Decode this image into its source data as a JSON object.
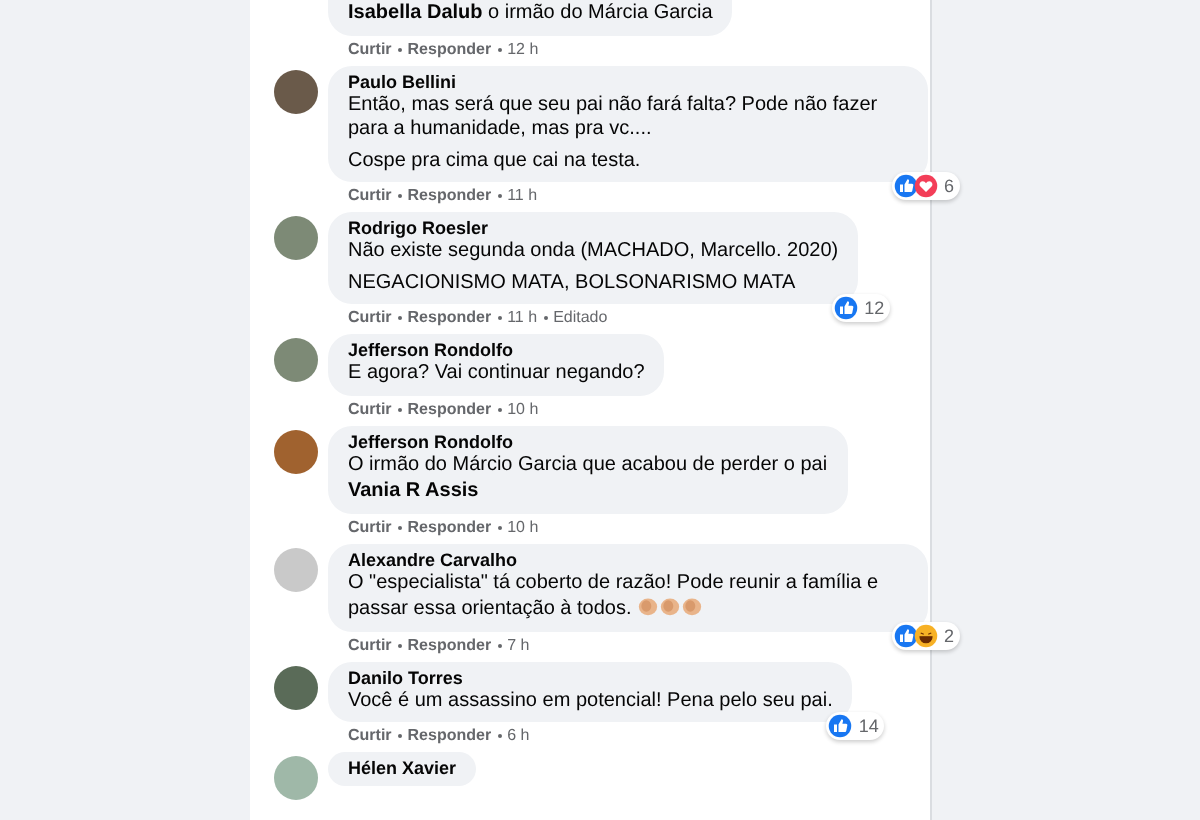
{
  "comments": [
    {
      "paragraphs": [
        "**Isabella Dalub** o irmão do Márcia Garcia"
      ],
      "actions": {
        "like": "Curtir",
        "reply": "Responder",
        "time": "12 h"
      }
    },
    {
      "author": "Paulo Bellini",
      "paragraphs": [
        "Então, mas será que seu pai não fará falta? Pode não fazer para a humanidade, mas pra vc....",
        "Cospe pra cima que cai na testa."
      ],
      "reactions": {
        "icons": [
          {
            "kind": "like"
          },
          {
            "kind": "love"
          }
        ],
        "count": "6"
      },
      "actions": {
        "like": "Curtir",
        "reply": "Responder",
        "time": "11 h"
      }
    },
    {
      "author": "Rodrigo Roesler",
      "paragraphs": [
        "Não existe segunda onda (MACHADO, Marcello. 2020)",
        "NEGACIONISMO MATA, BOLSONARISMO MATA"
      ],
      "reactions": {
        "icons": [
          {
            "kind": "like"
          }
        ],
        "count": "12"
      },
      "actions": {
        "like": "Curtir",
        "reply": "Responder",
        "time": "11 h",
        "edited": "Editado"
      }
    },
    {
      "author": "Jefferson Rondolfo",
      "paragraphs": [
        "E agora? Vai continuar negando?"
      ],
      "actions": {
        "like": "Curtir",
        "reply": "Responder",
        "time": "10 h"
      }
    },
    {
      "author": "Jefferson Rondolfo",
      "paragraphs": [
        "O irmão do Márcio Garcia que acabou de perder o pai"
      ],
      "mention": "Vania R Assis",
      "actions": {
        "like": "Curtir",
        "reply": "Responder",
        "time": "10 h"
      }
    },
    {
      "author": "Alexandre Carvalho",
      "paragraphs": [
        "O \"especialista\" tá coberto de razão! Pode reunir a família e passar essa orientação à todos."
      ],
      "emoji": [
        {
          "kind": "clap"
        },
        {
          "kind": "clap"
        },
        {
          "kind": "clap"
        }
      ],
      "reactions": {
        "icons": [
          {
            "kind": "like"
          },
          {
            "kind": "haha"
          }
        ],
        "count": "2"
      },
      "actions": {
        "like": "Curtir",
        "reply": "Responder",
        "time": "7 h"
      }
    },
    {
      "author": "Danilo Torres",
      "paragraphs": [
        "Você é um assassino em potencial! Pena pelo seu pai."
      ],
      "reactions": {
        "icons": [
          {
            "kind": "like"
          }
        ],
        "count": "14"
      },
      "actions": {
        "like": "Curtir",
        "reply": "Responder",
        "time": "6 h"
      }
    },
    {
      "author": "Hélen Xavier"
    }
  ]
}
